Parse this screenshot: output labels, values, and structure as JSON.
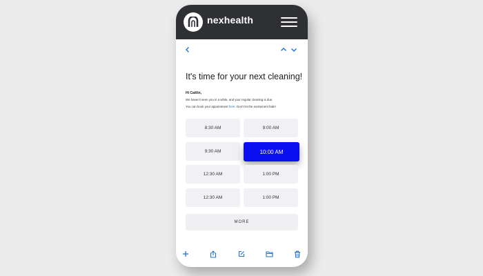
{
  "header": {
    "brand": "nexhealth",
    "logo_icon": "nexhealth-logo-icon",
    "menu_icon": "hamburger-menu-icon"
  },
  "nav": {
    "back_icon": "chevron-left-icon",
    "up_icon": "chevron-up-icon",
    "down_icon": "chevron-down-icon"
  },
  "email": {
    "headline": "It's time for your next cleaning!",
    "greeting": "Hi Caitlin,",
    "line1": "We haven't seen you in a while, and your regular cleaning is due.",
    "line2_prefix": "You can book your appointment ",
    "line2_link": "here",
    "line2_suffix": ". Don't let the excitement fade!"
  },
  "slots": [
    {
      "label": "8:30 AM",
      "selected": false
    },
    {
      "label": "9:00 AM",
      "selected": false
    },
    {
      "label": "9:30 AM",
      "selected": false
    },
    {
      "label": "10:00 AM",
      "selected": true
    },
    {
      "label": "12:30 AM",
      "selected": false
    },
    {
      "label": "1:00 PM",
      "selected": false
    },
    {
      "label": "12:30 AM",
      "selected": false
    },
    {
      "label": "1:00 PM",
      "selected": false
    }
  ],
  "more_label": "MORE",
  "toolbar": [
    "plus-icon",
    "share-icon",
    "compose-icon",
    "folder-icon",
    "trash-icon"
  ],
  "colors": {
    "accent": "#0a0ff0",
    "topbar": "#2e3033",
    "icon_blue": "#1f6fd6"
  }
}
